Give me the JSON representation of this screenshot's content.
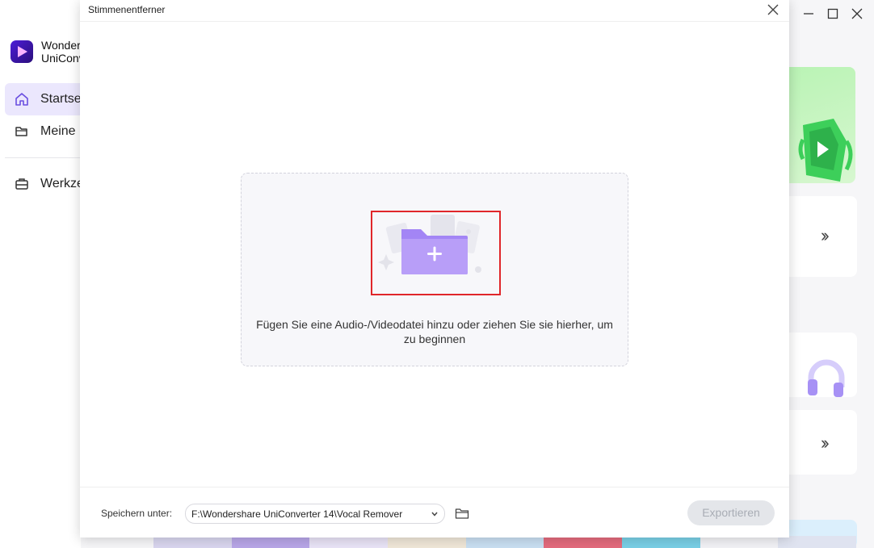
{
  "background_app": {
    "app_name": "Wondershare\nUniConverter",
    "nav": {
      "home": "Startseite",
      "my_files": "Meine Dateien",
      "tools": "Werkzeuge"
    }
  },
  "dialog": {
    "title": "Stimmenentferner",
    "drop_text": "Fügen Sie eine Audio-/Videodatei hinzu oder ziehen Sie sie hierher, um zu beginnen",
    "save_label": "Speichern unter:",
    "save_path": "F:\\Wondershare UniConverter 14\\Vocal Remover",
    "export_label": "Exportieren"
  },
  "colors": {
    "accent": "#8c6cf5",
    "highlight": "#e0262a",
    "export_disabled": "#e4e6ea"
  }
}
